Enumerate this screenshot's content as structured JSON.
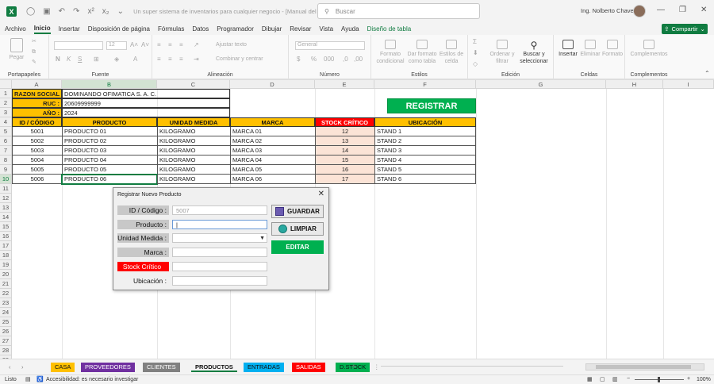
{
  "titlebar": {
    "app_icon": "X",
    "title": "Un super sistema de inventarios para cualquier negocio - [Manual del Usuario] - E...",
    "search_placeholder": "Buscar",
    "user_name": "Ing. Nolberto Chavez"
  },
  "menu": {
    "items": [
      "Archivo",
      "Inicio",
      "Insertar",
      "Disposición de página",
      "Fórmulas",
      "Datos",
      "Programador",
      "Dibujar",
      "Revisar",
      "Vista",
      "Ayuda",
      "Diseño de tabla"
    ],
    "active": "Inicio",
    "share_label": "Compartir"
  },
  "ribbon": {
    "paste_label": "Pegar",
    "groups": [
      "Portapapeles",
      "Fuente",
      "Alineación",
      "Número",
      "Estilos",
      "Edición",
      "Celdas",
      "Complementos"
    ],
    "font_size": "12",
    "font_bold": "N",
    "font_italic": "K",
    "font_underline": "S",
    "wrap_text": "Ajustar texto",
    "merge_center": "Combinar y centrar",
    "number_format": "General",
    "conditional_format": "Formato condicional",
    "format_as_table": "Dar formato como tabla",
    "cell_styles": "Estilos de celda",
    "sort_filter": "Ordenar y filtrar",
    "find_select": "Buscar y seleccionar",
    "insert": "Insertar",
    "delete": "Eliminar",
    "format": "Formato",
    "addins": "Complementos"
  },
  "sheet": {
    "columns": [
      "A",
      "B",
      "C",
      "D",
      "E",
      "F",
      "G",
      "H",
      "I"
    ],
    "rows": [
      "1",
      "2",
      "3",
      "4",
      "5",
      "6",
      "7",
      "8",
      "9",
      "10",
      "11",
      "12",
      "13",
      "14",
      "15",
      "16",
      "17",
      "18",
      "19",
      "20",
      "21",
      "22",
      "23",
      "24",
      "25",
      "26",
      "27",
      "28",
      "29"
    ],
    "company": {
      "razon_label": "RAZON SOCIAL :",
      "razon_value": "DOMINANDO OFIMATICA S. A. C.",
      "ruc_label": "RUC :",
      "ruc_value": "20609999999",
      "anio_label": "AÑO :",
      "anio_value": "2024"
    },
    "register_button": "REGISTRAR",
    "headers": [
      "ID / CÓDIGO",
      "PRODUCTO",
      "UNIDAD MEDIDA",
      "MARCA",
      "STOCK CRÍTICO",
      "UBICACIÓN"
    ],
    "products": [
      [
        "5001",
        "PRODUCTO 01",
        "KILOGRAMO",
        "MARCA 01",
        "12",
        "STAND 1"
      ],
      [
        "5002",
        "PRODUCTO 02",
        "KILOGRAMO",
        "MARCA 02",
        "13",
        "STAND 2"
      ],
      [
        "5003",
        "PRODUCTO 03",
        "KILOGRAMO",
        "MARCA 03",
        "14",
        "STAND 3"
      ],
      [
        "5004",
        "PRODUCTO 04",
        "KILOGRAMO",
        "MARCA 04",
        "15",
        "STAND 4"
      ],
      [
        "5005",
        "PRODUCTO 05",
        "KILOGRAMO",
        "MARCA 05",
        "16",
        "STAND 5"
      ],
      [
        "5006",
        "PRODUCTO 06",
        "KILOGRAMO",
        "MARCA 06",
        "17",
        "STAND 6"
      ]
    ]
  },
  "dialog": {
    "title": "Registrar Nuevo Producto",
    "labels": {
      "id": "ID / Código :",
      "producto": "Producto :",
      "unidad": "Unidad Medida :",
      "marca": "Marca :",
      "stock": "Stock Crítico",
      "ubicacion": "Ubicación :"
    },
    "values": {
      "id": "5007",
      "producto": "",
      "unidad": "",
      "marca": "",
      "stock": "",
      "ubicacion": ""
    },
    "buttons": {
      "guardar": "GUARDAR",
      "limpiar": "LIMPIAR",
      "editar": "EDITAR"
    }
  },
  "tabs": [
    {
      "label": "CASA",
      "color": "#ffc000",
      "text": "#111"
    },
    {
      "label": "PROVEEDORES",
      "color": "#7030a0",
      "text": "#fff"
    },
    {
      "label": "CLIENTES",
      "color": "#808080",
      "text": "#fff"
    },
    {
      "label": "PRODUCTOS",
      "color": "#ffffff",
      "text": "#111",
      "active": true
    },
    {
      "label": "ENTRADAS",
      "color": "#00b0f0",
      "text": "#111"
    },
    {
      "label": "SALIDAS",
      "color": "#ff0000",
      "text": "#fff"
    },
    {
      "label": "D.STOCK",
      "color": "#00b050",
      "text": "#111"
    }
  ],
  "status": {
    "ready": "Listo",
    "accessibility": "Accesibilidad: es necesario investigar",
    "zoom": "100%"
  },
  "colors": {
    "excel_green": "#107c41",
    "header_yellow": "#ffc000",
    "stock_red": "#ff0000",
    "button_green": "#00b050"
  }
}
